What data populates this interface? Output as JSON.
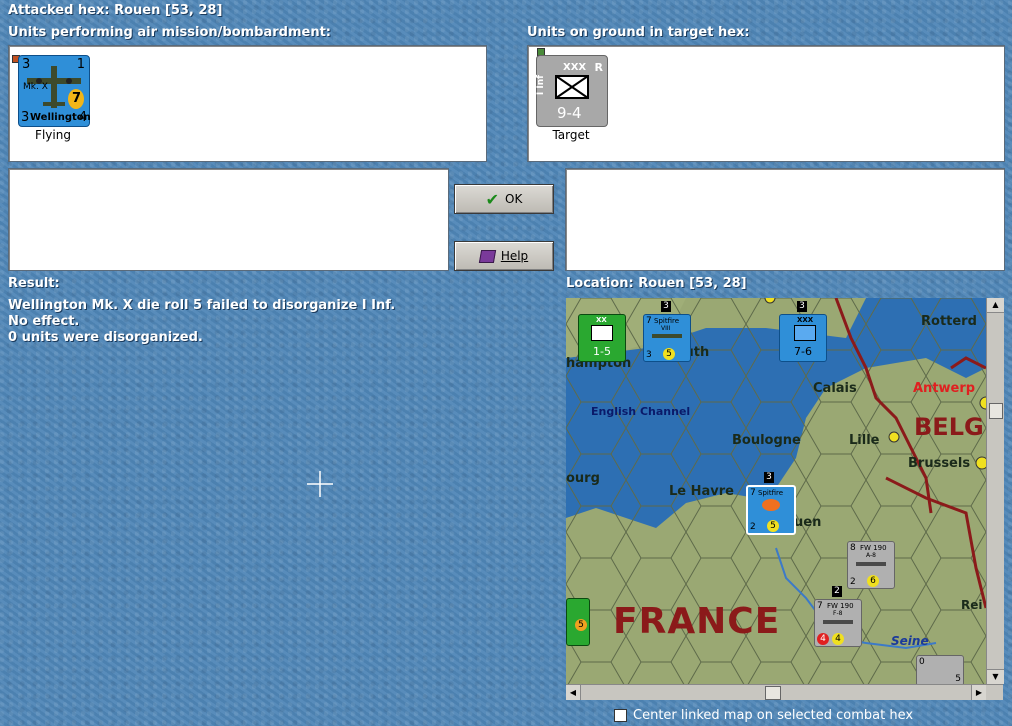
{
  "header": {
    "attacked_hex": "Attacked hex: Rouen  [53, 28]"
  },
  "air_panel": {
    "title": "Units performing air mission/bombardment:",
    "unit": {
      "name": "Wellington",
      "model": "Mk. X",
      "tl": "3",
      "tr": "1",
      "bl": "3",
      "br": "4",
      "badge": "7",
      "status": "Flying"
    }
  },
  "ground_panel": {
    "title": "Units on ground in target hex:",
    "unit": {
      "size": "XXX",
      "type": "R",
      "side_label": "I Inf",
      "strength": "9-4",
      "status": "Target"
    }
  },
  "buttons": {
    "ok": "OK",
    "help": "Help"
  },
  "result": {
    "title": "Result:",
    "lines": [
      "Wellington Mk. X die roll 5 failed to disorganize I Inf.",
      "No effect.",
      "0 units were disorganized."
    ]
  },
  "location": {
    "title": "Location:  Rouen  [53, 28]"
  },
  "map": {
    "labels": {
      "english_channel": "English Channel",
      "calais": "Calais",
      "antwerp": "Antwerp",
      "rotterdam": "Rotterd",
      "boulogne": "Boulogne",
      "lille": "Lille",
      "belg": "BELG",
      "brussels": "Brussels",
      "ourg": "ourg",
      "le_havre": "Le Havre",
      "uen": "uen",
      "france": "FRANCE",
      "seine": "Seine",
      "rei": "Rei",
      "mouth": "mouth",
      "hampton": "hampton"
    },
    "counters": {
      "c1": {
        "size": "XX",
        "str": "1-5"
      },
      "c2": {
        "name": "Spitfire",
        "sub": "VIII",
        "a": "7",
        "b": "3",
        "c": "5",
        "stack": "3"
      },
      "c3": {
        "size": "XXX",
        "str": "7-6",
        "stack": "3"
      },
      "c4": {
        "name": "Spitfire",
        "a": "7",
        "b": "2",
        "c": "5",
        "stack": "3"
      },
      "c5": {
        "name": "FW 190",
        "sub": "A-8",
        "a": "8",
        "b": "2",
        "c": "6"
      },
      "c6": {
        "name": "FW 190",
        "sub": "F-8",
        "a": "7",
        "b": "4",
        "c": "4",
        "stack": "2"
      },
      "c7": {
        "a": "0",
        "b": "5"
      },
      "c8": {
        "a": "5"
      }
    }
  },
  "checkbox": {
    "label": "Center linked map on selected combat hex",
    "checked": false
  },
  "colors": {
    "panel_bg": "#ffffff",
    "ocean": "#4f86b7",
    "air_unit": "#2f8fd8",
    "ground_unit": "#a8a8a8",
    "france_text": "#8b1a1a",
    "antwerp_text": "#e02020"
  }
}
